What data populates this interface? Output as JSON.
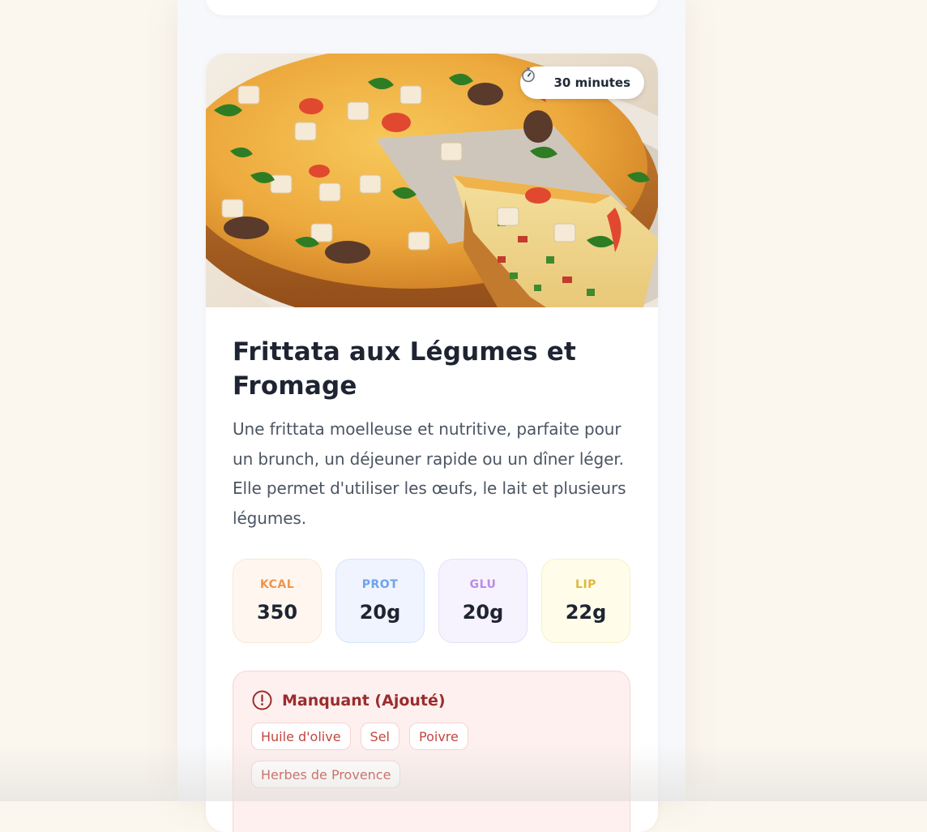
{
  "recipe": {
    "time_label": "30 minutes",
    "time_icon": "stopwatch-icon",
    "title": "Frittata aux Légumes et Fromage",
    "description": "Une frittata moelleuse et nutritive, parfaite pour un brunch, un déjeuner rapide ou un dîner léger. Elle permet d'utiliser les œufs, le lait et plusieurs légumes.",
    "macros": [
      {
        "label": "KCAL",
        "value": "350",
        "color": "#f0954e"
      },
      {
        "label": "PROT",
        "value": "20g",
        "color": "#6ea2ec"
      },
      {
        "label": "GLU",
        "value": "20g",
        "color": "#b98ce9"
      },
      {
        "label": "LIP",
        "value": "22g",
        "color": "#e0b73a"
      }
    ],
    "missing": {
      "title": "Manquant (Ajouté)",
      "icon": "alert-circle-icon",
      "color": "#9b2c2c",
      "items": [
        "Huile d'olive",
        "Sel",
        "Poivre",
        "Herbes de Provence"
      ]
    }
  }
}
